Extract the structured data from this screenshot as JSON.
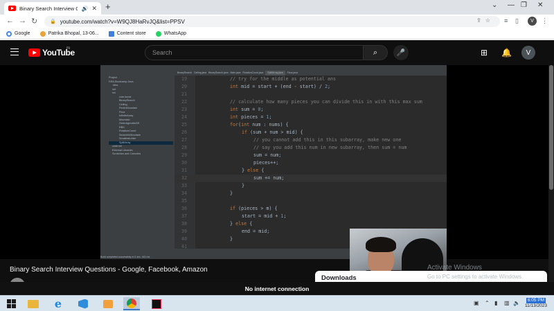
{
  "browser": {
    "tab_title": "Binary Search Interview Questi",
    "new_tab": "+",
    "url": "youtube.com/watch?v=W9QJ8HaRvJQ&list=PPSV",
    "profile_initial": "V"
  },
  "bookmarks": [
    {
      "label": "Google",
      "color": "#4285f4"
    },
    {
      "label": "Patrika Bhopal, 13-06...",
      "color": "#e8a33d"
    },
    {
      "label": "Content store",
      "color": "#3f7fd9"
    },
    {
      "label": "WhatsApp",
      "color": "#25d366"
    }
  ],
  "youtube": {
    "logo": "YouTube",
    "country": "IN",
    "search_placeholder": "Search",
    "avatar": "V",
    "video_title": "Binary Search Interview Questions - Google, Facebook, Amazon",
    "downloads": "Downloads"
  },
  "ide": {
    "tabs": [
      {
        "label": "BinarySearch",
        "active": false
      },
      {
        "label": "Ceiling.java",
        "active": false
      },
      {
        "label": "BinarySearch.java",
        "active": false
      },
      {
        "label": "Main.java",
        "active": false
      },
      {
        "label": "RotationCount.java",
        "active": false
      },
      {
        "label": "SplitArray.java",
        "active": true
      },
      {
        "label": "Floor.java",
        "active": false
      }
    ],
    "project_tree": [
      "Project",
      "DSA-Bootcamp-Java",
      ".idea",
      "out",
      "src",
      "com.kunal",
      "BinarySearch",
      "Ceiling",
      "FindInMountain",
      "Floor",
      "InfiniteArray",
      "Mountain",
      "OrderAgnosticBS",
      "RBS",
      "RotationCount",
      "SearchInMountain",
      "SmallestLetter",
      "SplitArray",
      "code.iml",
      "External Libraries",
      "Scratches and Consoles"
    ],
    "selected_item": "SplitArray",
    "status": "Build completed successfully in 2 sec, 441 ms"
  },
  "code_lines": [
    {
      "no": "19",
      "text": "// try for the middle as potential ans",
      "type": "cm",
      "indent": 2
    },
    {
      "no": "20",
      "text": "int mid = start + (end - start) / 2;",
      "type": "code",
      "indent": 2
    },
    {
      "no": "21",
      "text": "",
      "type": "code",
      "indent": 0
    },
    {
      "no": "22",
      "text": "// calculate how many pieces you can divide this in with this max sum",
      "type": "cm",
      "indent": 2
    },
    {
      "no": "23",
      "text": "int sum = 0;",
      "type": "code",
      "indent": 2
    },
    {
      "no": "24",
      "text": "int pieces = 1;",
      "type": "code",
      "indent": 2
    },
    {
      "no": "25",
      "text": "for(int num : nums) {",
      "type": "code",
      "indent": 2
    },
    {
      "no": "26",
      "text": "if (sum + num > mid) {",
      "type": "code",
      "indent": 3
    },
    {
      "no": "27",
      "text": "// you cannot add this in this subarray, make new one",
      "type": "cm",
      "indent": 4
    },
    {
      "no": "28",
      "text": "// say you add this num in new subarray, then sum = num",
      "type": "cm",
      "indent": 4
    },
    {
      "no": "29",
      "text": "sum = num;",
      "type": "code",
      "indent": 4
    },
    {
      "no": "30",
      "text": "pieces++;",
      "type": "code",
      "indent": 4
    },
    {
      "no": "31",
      "text": "} else {",
      "type": "code",
      "indent": 3
    },
    {
      "no": "32",
      "text": "sum += num;",
      "type": "code",
      "indent": 4
    },
    {
      "no": "33",
      "text": "}",
      "type": "code",
      "indent": 3
    },
    {
      "no": "34",
      "text": "}",
      "type": "code",
      "indent": 2
    },
    {
      "no": "35",
      "text": "",
      "type": "code",
      "indent": 0
    },
    {
      "no": "36",
      "text": "if (pieces > m) {",
      "type": "code",
      "indent": 2
    },
    {
      "no": "37",
      "text": "start = mid + 1;",
      "type": "code",
      "indent": 3
    },
    {
      "no": "38",
      "text": "} else {",
      "type": "code",
      "indent": 2
    },
    {
      "no": "39",
      "text": "end = mid;",
      "type": "code",
      "indent": 3
    },
    {
      "no": "40",
      "text": "}",
      "type": "code",
      "indent": 2
    },
    {
      "no": "41",
      "text": "",
      "type": "code",
      "indent": 0
    }
  ],
  "current_line": "32",
  "windows": {
    "activate_title": "Activate Windows",
    "activate_sub": "Go to PC settings to activate Windows."
  },
  "offline_message": "No internet connection",
  "taskbar": {
    "time": "6:05 PM",
    "date": "11/13/2023"
  },
  "colors": {
    "youtube_red": "#ff0000",
    "youtube_bg": "#0f0f0f",
    "ide_bg": "#2b2b2b",
    "comment": "#808080",
    "keyword": "#cc7832"
  }
}
